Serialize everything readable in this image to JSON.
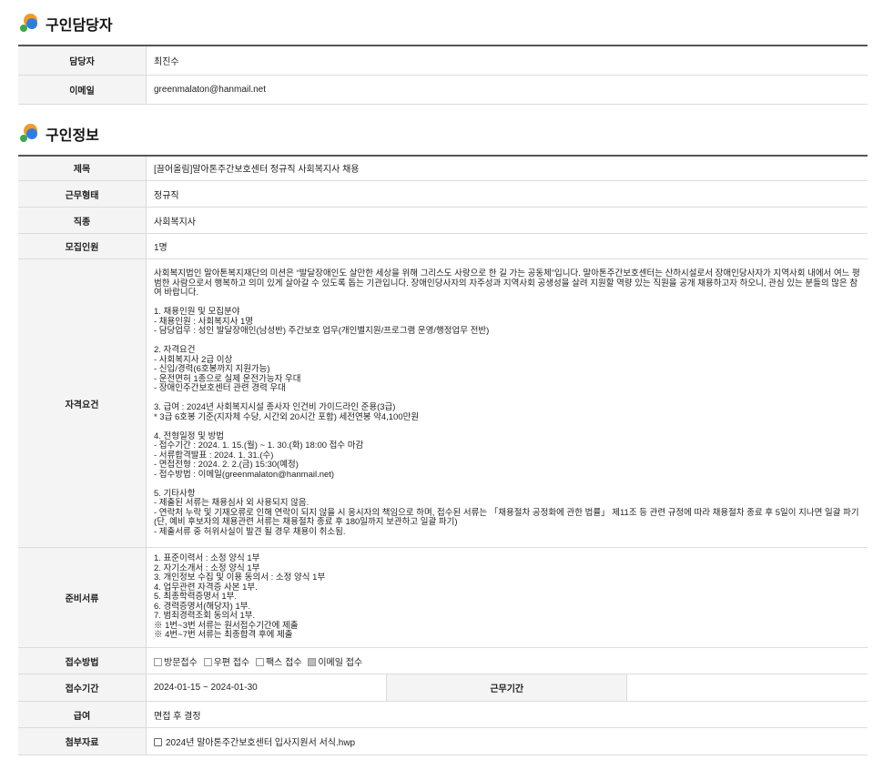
{
  "manager_section": {
    "title": "구인담당자",
    "rows": {
      "manager_label": "담당자",
      "manager_value": "최진수",
      "email_label": "이메일",
      "email_value": "greenmalaton@hanmail.net"
    }
  },
  "job_section": {
    "title": "구인정보",
    "rows": {
      "title_label": "제목",
      "title_value": "[끌어올림]말아톤주간보호센터 정규직 사회복지사 채용",
      "employment_label": "근무형태",
      "employment_value": "정규직",
      "occupation_label": "직종",
      "occupation_value": "사회복지사",
      "headcount_label": "모집인원",
      "headcount_value": "1명",
      "qualification_label": "자격요건",
      "qualification_text": "사회복지법인 말아톤복지재단의 미션은 “발달장애인도 살만한 세상을 위해 그리스도 사랑으로 한 길 가는 공동체”입니다. 말아톤주간보호센터는 산하시설로서 장애인당사자가 지역사회 내에서 여느 평범한 사람으로서 행복하고 의미 있게 살아갈 수 있도록 돕는 기관입니다. 장애인당사자의 자주성과 지역사회 공생성을 살려 지원할 역량 있는 직원을 공개 채용하고자 하오니, 관심 있는 분들의 많은 참여 바랍니다.\n\n1. 채용인원 및 모집분야\n- 채용인원 : 사회복지사 1명\n- 담당업무 : 성인 발달장애인(남성반) 주간보호 업무(개인별지원/프로그램 운영/행정업무 전반)\n\n2. 자격요건\n- 사회복지사 2급 이상\n- 신입/경력(6호봉까지 지원가능)\n- 운전면허 1종으로 실제 운전가능자 우대\n- 장애인주간보호센터 관련 경력 우대\n\n3. 급여 : 2024년 사회복지시설 종사자 인건비 가이드라인 준용(3급)\n* 3급 6호봉 기준(지자체 수당, 시간외 20시간 포함) 세전연봉 약4,100만원\n\n4. 전형일정 및 방법\n- 접수기간 : 2024. 1. 15.(월) ~ 1. 30.(화) 18:00 접수 마감\n- 서류합격발표 : 2024. 1. 31.(수)\n- 면접전형 : 2024. 2. 2.(금) 15:30(예정)\n- 접수방법 : 이메일(greenmalaton@hanmail.net)\n\n5. 기타사항\n- 제출된 서류는 채용심사 외 사용되지 않음.\n- 연락처 누락 및 기재오류로 인해 연락이 되지 않을 시 응시자의 책임으로 하며, 접수된 서류는 「채용절차 공정화에 관한 법률」 제11조 등 관련 규정에 따라 채용절차 종료 후 5일이 지나면 일괄 파기(단, 예비 후보자의 채용관련 서류는 채용절차 종료 후 180일까지 보관하고 일괄 파기)\n- 제출서류 중 허위사실이 발견 될 경우 채용이 취소됨.",
      "documents_label": "준비서류",
      "documents_text": "1. 표준이력서 : 소정 양식 1부\n2. 자기소개서 : 소정 양식 1부\n3. 개인정보 수집 및 이용 동의서 : 소정 양식 1부\n4. 업무관련 자격증 사본 1부.\n5. 최종학력증명서 1부.\n6. 경력증명서(해당자) 1부.\n7. 범죄경력조회 동의서 1부.\n※ 1번~3번 서류는 원서접수기간에 제출\n※ 4번~7번 서류는 최종합격 후에 제출",
      "method_label": "접수방법",
      "method_options": [
        {
          "label": "방문접수",
          "checked": false
        },
        {
          "label": "우편 접수",
          "checked": false
        },
        {
          "label": "팩스 접수",
          "checked": false
        },
        {
          "label": "이메일 접수",
          "checked": true
        }
      ],
      "period_label": "접수기간",
      "period_value": "2024-01-15 ~ 2024-01-30",
      "workperiod_label": "근무기간",
      "workperiod_value": "",
      "salary_label": "급여",
      "salary_value": "면접 후 결정",
      "attachment_label": "첨부자료",
      "attachment_value": "2024년 말아톤주간보호센터 입사지원서 서식.hwp"
    }
  }
}
